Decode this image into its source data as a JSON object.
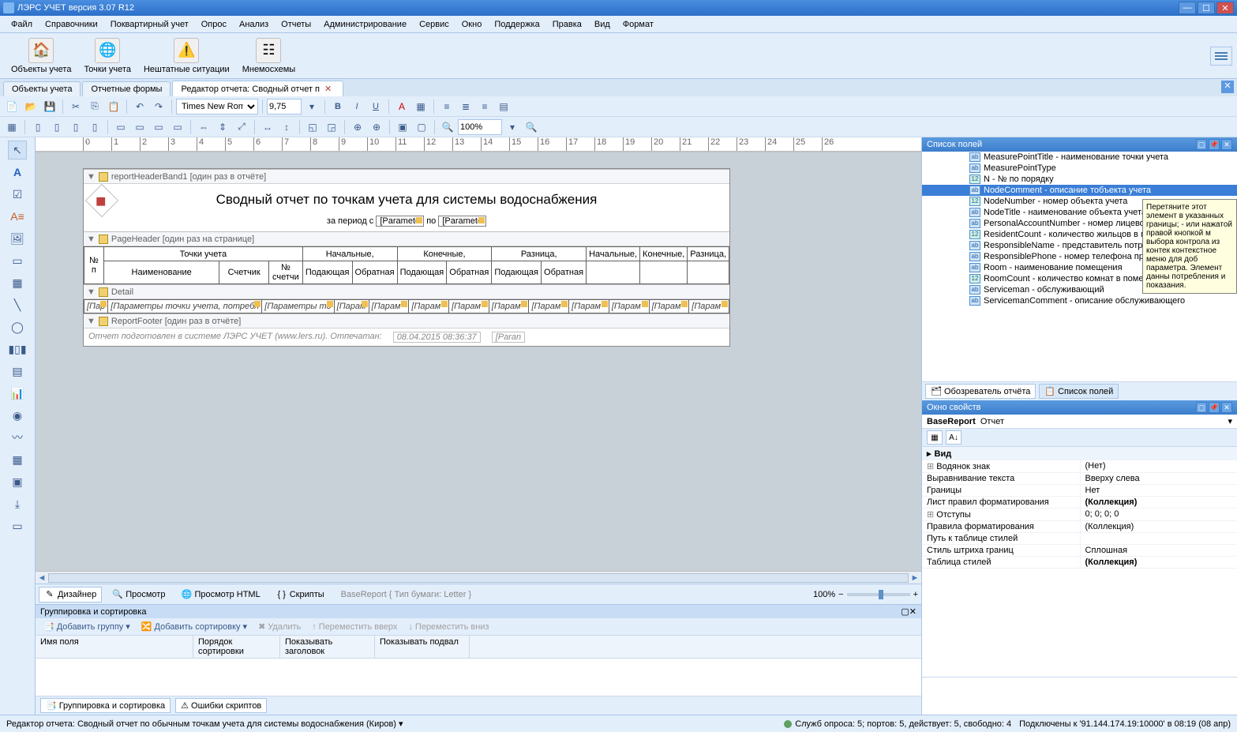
{
  "titlebar": {
    "title": "ЛЭРС УЧЕТ версия 3.07 R12"
  },
  "menu": [
    "Файл",
    "Справочники",
    "Поквартирный учет",
    "Опрос",
    "Анализ",
    "Отчеты",
    "Администрирование",
    "Сервис",
    "Окно",
    "Поддержка",
    "Правка",
    "Вид",
    "Формат"
  ],
  "ribbon": {
    "objects": "Объекты учета",
    "points": "Точки учета",
    "abnormal": "Нештатные ситуации",
    "mnemo": "Мнемосхемы"
  },
  "tabs": {
    "t1": "Объекты учета",
    "t2": "Отчетные формы",
    "t3": "Редактор отчета: Сводный отчет п"
  },
  "toolbar": {
    "font": "Times New Roman",
    "fontsize": "9,75",
    "zoom": "100%"
  },
  "bands": {
    "header": "reportHeaderBand1 [один раз в отчёте]",
    "page": "PageHeader [один раз на странице]",
    "detail": "Detail",
    "footer": "ReportFooter [один раз в отчёте]"
  },
  "report": {
    "title": "Сводный отчет по точкам учета для системы водоснабжения",
    "periodPrefix": "за период с",
    "param": "[Paramete",
    "to": "по",
    "tbl": {
      "num": "№ п",
      "points": "Точки учета",
      "start": "Начальные,",
      "end": "Конечные,",
      "diff": "Разница,",
      "start2": "Начальные,",
      "end2": "Конечные,",
      "diff2": "Разница,",
      "name": "Наименование",
      "meter": "Счетчик",
      "metnum": "№ счетчи",
      "supply": "Подающая",
      "return": "Обратная"
    },
    "detail": {
      "c1": "[Пар",
      "c2": "[Параметры точки учета, потребл",
      "c3": "[Параметры то",
      "c4": "[Парам",
      "c5": "[Парам",
      "c6": "[Парам",
      "c7": "[Парам",
      "c8": "[Парам",
      "c9": "[Парам",
      "c10": "[Парам",
      "c11": "[Парам",
      "c12": "[Парам",
      "c13": "[Парам"
    },
    "footer": {
      "text": "Отчет подготовлен в системе ЛЭРС УЧЕТ (www.lers.ru). Отпечатан:",
      "date": "08.04.2015 08:36:37",
      "param": "[Paran"
    }
  },
  "designtabs": {
    "designer": "Дизайнер",
    "preview": "Просмотр",
    "html": "Просмотр HTML",
    "scripts": "Скрипты",
    "info": "BaseReport { Тип бумаги: Letter }",
    "zoom": "100%"
  },
  "grouping": {
    "title": "Группировка и сортировка",
    "addgroup": "Добавить группу",
    "addsort": "Добавить сортировку",
    "delete": "Удалить",
    "moveup": "Переместить вверх",
    "movedown": "Переместить вниз",
    "col1": "Имя поля",
    "col2": "Порядок сортировки",
    "col3": "Показывать заголовок",
    "col4": "Показывать подвал",
    "tab1": "Группировка и сортировка",
    "tab2": "Ошибки скриптов"
  },
  "fieldpanel": {
    "title": "Список полей",
    "items": [
      {
        "name": "MeasurePointTitle - наименование точки учета",
        "icon": "ab"
      },
      {
        "name": "MeasurePointType",
        "icon": "ab"
      },
      {
        "name": "N - № по порядку",
        "icon": "12"
      },
      {
        "name": "NodeComment - описание тобъекта учета",
        "icon": "ab",
        "selected": true
      },
      {
        "name": "NodeNumber - номер объекта учета",
        "icon": "12"
      },
      {
        "name": "NodeTitle - наименование объекта учета",
        "icon": "ab"
      },
      {
        "name": "PersonalAccountNumber - номер лицевого",
        "icon": "ab"
      },
      {
        "name": "ResidentCount - количество жильцов в по",
        "icon": "12"
      },
      {
        "name": "ResponsibleName - представитель потреб",
        "icon": "ab"
      },
      {
        "name": "ResponsiblePhone - номер телефона предс",
        "icon": "ab"
      },
      {
        "name": "Room - наименование помещения",
        "icon": "ab"
      },
      {
        "name": "RoomCount - количество комнат в помещении",
        "icon": "12"
      },
      {
        "name": "Serviceman - обслуживающий",
        "icon": "ab"
      },
      {
        "name": "ServicemanComment - описание обслуживающего",
        "icon": "ab"
      }
    ],
    "tooltip": "Перетяните этот элемент в указанных границы; - или нажатой правой кнопкой м выбора контрола из контек контекстное меню для доб параметра. Элемент данны потребления и показания.",
    "tab1": "Обозреватель отчёта",
    "tab2": "Список полей"
  },
  "props": {
    "title": "Окно свойств",
    "object": "BaseReport",
    "objecttype": "Отчет",
    "cat": "Вид",
    "rows": [
      {
        "name": "Водянок знак",
        "val": "(Нет)",
        "exp": true
      },
      {
        "name": "Выравнивание текста",
        "val": "Вверху слева"
      },
      {
        "name": "Границы",
        "val": "Нет"
      },
      {
        "name": "Лист правил форматирования",
        "val": "(Коллекция)",
        "bold": true
      },
      {
        "name": "Отступы",
        "val": "0; 0; 0; 0",
        "exp": true
      },
      {
        "name": "Правила форматирования",
        "val": "(Коллекция)"
      },
      {
        "name": "Путь к таблице стилей",
        "val": ""
      },
      {
        "name": "Стиль штриха границ",
        "val": "Сплошная"
      },
      {
        "name": "Таблица стилей",
        "val": "(Коллекция)",
        "bold": true
      }
    ]
  },
  "status": {
    "text": "Редактор отчета: Сводный отчет по обычным точкам учета для системы водоснабжения (Киров)",
    "services": "Служб опроса: 5; портов: 5, действует: 5, свободно: 4",
    "conn": "Подключены к '91.144.174.19:10000' в 08:19 (08 апр)"
  }
}
